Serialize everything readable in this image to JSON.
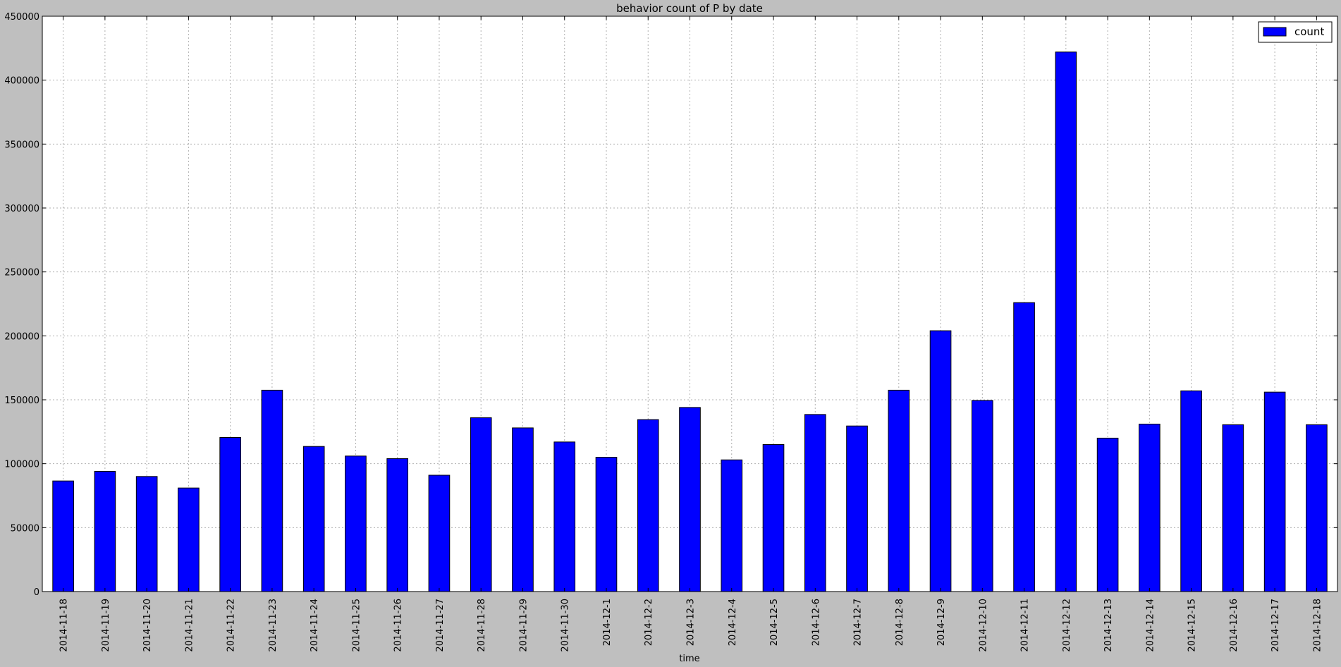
{
  "chart_data": {
    "type": "bar",
    "title": "behavior count of P by date",
    "xlabel": "time",
    "ylabel": "",
    "ylim": [
      0,
      450000
    ],
    "yticks": [
      0,
      50000,
      100000,
      150000,
      200000,
      250000,
      300000,
      350000,
      400000,
      450000
    ],
    "grid": true,
    "legend_position": "top-right",
    "categories": [
      "2014-11-18",
      "2014-11-19",
      "2014-11-20",
      "2014-11-21",
      "2014-11-22",
      "2014-11-23",
      "2014-11-24",
      "2014-11-25",
      "2014-11-26",
      "2014-11-27",
      "2014-11-28",
      "2014-11-29",
      "2014-11-30",
      "2014-12-1",
      "2014-12-2",
      "2014-12-3",
      "2014-12-4",
      "2014-12-5",
      "2014-12-6",
      "2014-12-7",
      "2014-12-8",
      "2014-12-9",
      "2014-12-10",
      "2014-12-11",
      "2014-12-12",
      "2014-12-13",
      "2014-12-14",
      "2014-12-15",
      "2014-12-16",
      "2014-12-17",
      "2014-12-18"
    ],
    "series": [
      {
        "name": "count",
        "color": "#0000ff",
        "values": [
          86500,
          94000,
          90000,
          81000,
          120500,
          157500,
          113500,
          106000,
          104000,
          91000,
          136000,
          128000,
          117000,
          105000,
          134500,
          144000,
          103000,
          115000,
          138500,
          129500,
          157500,
          204000,
          149500,
          226000,
          422000,
          120000,
          131000,
          157000,
          130500,
          156000,
          130500
        ]
      }
    ]
  },
  "colors": {
    "background": "#bfbfbf",
    "plot_area": "#ffffff",
    "bar": "#0000ff",
    "grid": "#b0b0b0"
  }
}
